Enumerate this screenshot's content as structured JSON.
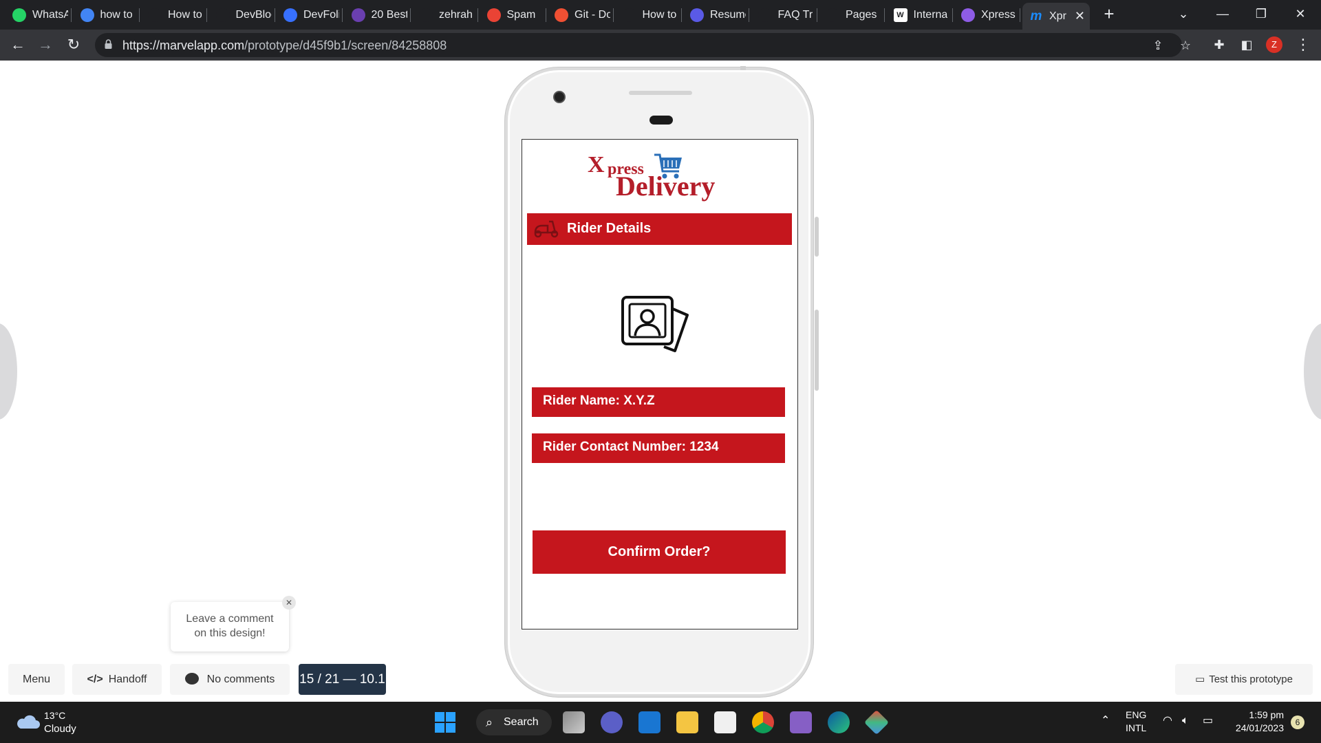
{
  "browser": {
    "tabs": [
      {
        "title": "WhatsApp",
        "icon": "whatsapp-icon",
        "color": "#25d366"
      },
      {
        "title": "how to",
        "icon": "google-icon",
        "color": "#4285f4"
      },
      {
        "title": "How to",
        "icon": "openai-icon",
        "color": "#202124"
      },
      {
        "title": "DevBlog",
        "icon": "heart-icon",
        "color": "#202124"
      },
      {
        "title": "DevFolio",
        "icon": "devfolio-icon",
        "color": "#3770ff"
      },
      {
        "title": "20 Best",
        "icon": "colorlib-icon",
        "color": "#6a3fb0"
      },
      {
        "title": "zehrah",
        "icon": "github-icon",
        "color": "#202124"
      },
      {
        "title": "Spam",
        "icon": "gmail-icon",
        "color": "#ea4335"
      },
      {
        "title": "Git - Do",
        "icon": "git-icon",
        "color": "#f05033"
      },
      {
        "title": "How to",
        "icon": "a-logo-icon",
        "color": "#202124"
      },
      {
        "title": "Resume",
        "icon": "resume-icon",
        "color": "#5a5ae6"
      },
      {
        "title": "FAQ Tr",
        "icon": "wordpress-icon",
        "color": "#202124"
      },
      {
        "title": "Pages",
        "icon": "github-icon",
        "color": "#202124"
      },
      {
        "title": "Interna",
        "icon": "w-logo-icon",
        "color": "#ffffff"
      },
      {
        "title": "Xpress",
        "icon": "marvel-icon",
        "color": "#8e5ce6"
      }
    ],
    "active_tab": {
      "title": "Xpr",
      "icon": "marvel-icon",
      "color": "#1a8cff"
    },
    "url_host": "https://marvelapp.com",
    "url_path": "/prototype/d45f9b1/screen/84258808",
    "profile_initial": "Z"
  },
  "app": {
    "logo_x": "X",
    "logo_press": "press",
    "logo_delivery": "Delivery",
    "header_title": "Rider Details",
    "rider_name": "Rider Name: X.Y.Z",
    "rider_contact": "Rider Contact Number: 1234",
    "confirm_label": "Confirm Order?",
    "accent_color": "#c5161d"
  },
  "marvel": {
    "comment_prompt_line1": "Leave a comment",
    "comment_prompt_line2": "on this design!",
    "menu_label": "Menu",
    "handoff_label": "Handoff",
    "comments_label": "No comments",
    "screen_counter": "15 / 21 — 10.1",
    "test_label": "Test this prototype"
  },
  "taskbar": {
    "temperature": "13°C",
    "condition": "Cloudy",
    "search_label": "Search",
    "lang_line1": "ENG",
    "lang_line2": "INTL",
    "time": "1:59 pm",
    "date": "24/01/2023",
    "notification_count": "6"
  }
}
